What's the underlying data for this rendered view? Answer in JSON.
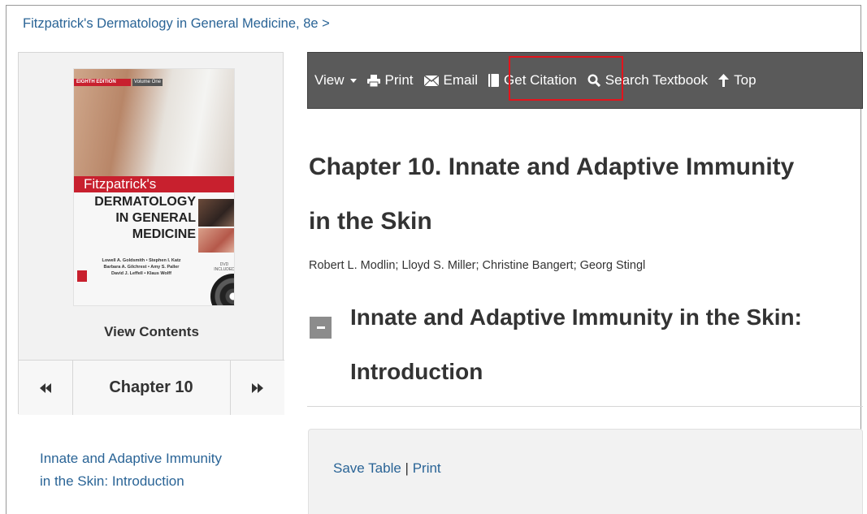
{
  "breadcrumb": "Fitzpatrick's Dermatology in General Medicine, 8e >",
  "book": {
    "cover": {
      "edition_label": "EIGHTH EDITION",
      "volume_label": "Volume One",
      "series_name": "Fitzpatrick's",
      "title_line1": "DERMATOLOGY",
      "title_line2": "IN GENERAL",
      "title_line3": "MEDICINE",
      "authors_line1": "Lowell A. Goldsmith • Stephen I. Katz",
      "authors_line2": "Barbara A. Gilchrest • Amy S. Paller",
      "authors_line3": "David J. Leffell • Klaus Wolff",
      "dvd_label": "DVD INCLUDED",
      "brand_color": "#c8202e"
    },
    "view_contents_label": "View Contents"
  },
  "chapter_nav": {
    "prev_icon": "fast-backward-icon",
    "label": "Chapter 10",
    "next_icon": "fast-forward-icon"
  },
  "toc": {
    "current_item": "Innate and Adaptive Immunity in the Skin: Introduction"
  },
  "toolbar": {
    "background": "#5a5a5a",
    "view_label": "View",
    "print_label": "Print",
    "email_label": "Email",
    "citation_label": "Get Citation",
    "search_label": "Search Textbook",
    "top_label": "Top",
    "highlight_color": "#e3141c"
  },
  "content": {
    "chapter_title": "Chapter 10. Innate and Adaptive Immunity in the Skin",
    "authors": "Robert L. Modlin; Lloyd S. Miller; Christine Bangert; Georg Stingl",
    "section_title": "Innate and Adaptive Immunity in the Skin: Introduction",
    "table_actions": {
      "save_label": "Save Table",
      "separator": "|",
      "print_label": "Print"
    }
  },
  "link_color": "#2a6496"
}
